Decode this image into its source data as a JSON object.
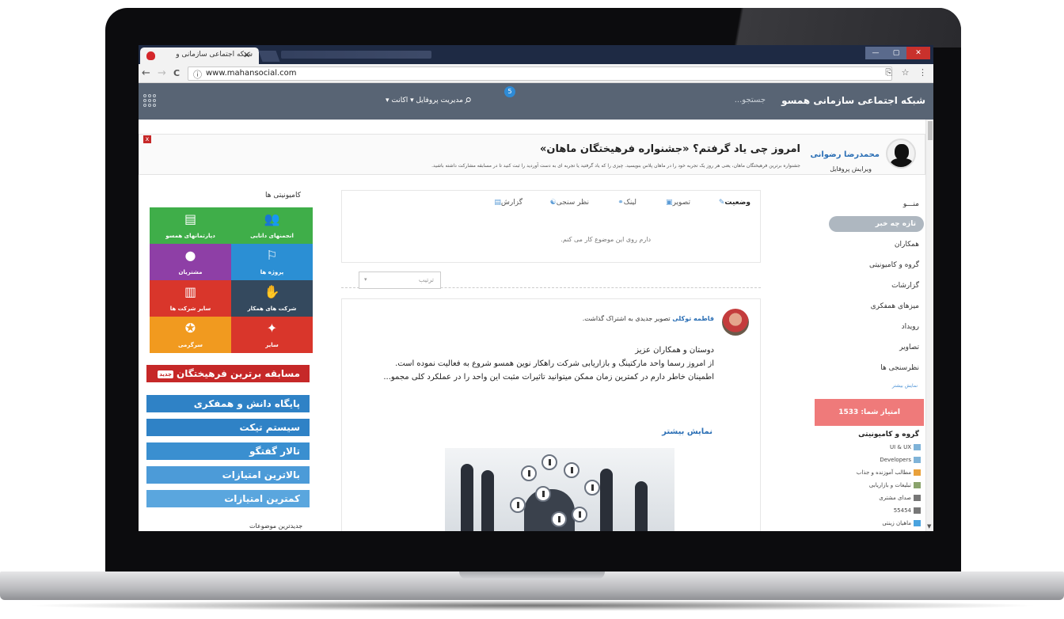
{
  "browser": {
    "tab_title": "شبکه اجتماعی سازمانی و",
    "tab_close": "✕",
    "url": "www.mahansocial.com",
    "nav_back": "←",
    "nav_forward": "→",
    "nav_reload": "C",
    "info_icon": "ⓘ",
    "translate_icon": "⎘",
    "bookmark_icon": "☆",
    "menu_icon": "⋮"
  },
  "header": {
    "brand": "شبکه اجتماعی سازمانی همسو",
    "search_placeholder": "جستجو...",
    "search_icon": "⌕",
    "notification_count": "5",
    "menu": "پنل مدیریت   پروفایل ▾   اکانت ▾"
  },
  "banner": {
    "user_name": "محمدرضا رضوانی",
    "edit_profile": "ویرایش پروفایل",
    "title": "امروز چی یاد گرفتم؟ «جشنواره فرهیختگان ماهان»",
    "description": "جشنواره برترین فرهیختگان ماهان، یعنی هر روز یک تجربه خود را در ماهان پلاس بنویسید. چیزی را که یاد گرفتید یا تجربه ای به دست آوردید را ثبت کنید تا در مسابقه مشارکت داشته باشید.",
    "close": "x"
  },
  "nav": {
    "title": "منـــو",
    "items": [
      "تازه چه خبر",
      "همکاران",
      "گروه و کامیونیتی",
      "گزارشات",
      "میزهای همفکری",
      "رویداد",
      "تصاویر",
      "نظرسنجی ها"
    ],
    "more": "نمایش بیشتر",
    "points": "امتیاز شما: 1533",
    "groups_title": "گروه و کامیونیتی",
    "groups": [
      "UI & UX",
      "Developers",
      "مطالب آموزنده و جذاب",
      "تبلیغات و بازاریابی",
      "صدای مشتری",
      "55454",
      "ماهیان زینتی"
    ]
  },
  "composer": {
    "tabs": [
      "وضعیت",
      "تصویر",
      "لینک",
      "نظر سنجی",
      "گزارش"
    ],
    "tab_icons": [
      "✎",
      "▣",
      "⚭",
      "☯",
      "▤"
    ],
    "placeholder": "دارم روی این موضوع کار می کنم.",
    "sort_label": "ترتیب",
    "sort_arrow": "▾"
  },
  "post": {
    "author": "فاطمه توکلی",
    "action": " تصویر جدیدی به اشتراک گذاشت.",
    "body": "دوستان و همکاران عزیز\nاز امروز رسما واحد مارکتینگ و بازاریابی شرکت راهکار نوین همسو شروع به فعالیت نموده است.\nاطمینان خاطر دارم در کمترین زمان ممکن میتوانید تاثیرات مثبت این واحد را در عملکرد کلی مجمو...",
    "more": "نمایش بیشتر"
  },
  "left": {
    "communities_title": "کامیونیتی ها",
    "tiles": [
      {
        "label": "انجمنهای دانایی",
        "icon": "👥",
        "color": "#3fae49"
      },
      {
        "label": "دپارتمانهای همسو",
        "icon": "▤",
        "color": "#3fae49"
      },
      {
        "label": "پروژه ها",
        "icon": "⚐",
        "color": "#2b8fd4"
      },
      {
        "label": "مشتریان",
        "icon": "●",
        "color": "#8e3fa6"
      },
      {
        "label": "شرکت های همکار",
        "icon": "✋",
        "color": "#34495e"
      },
      {
        "label": "سایر شرکت ها",
        "icon": "▥",
        "color": "#d9362b"
      },
      {
        "label": "سایر",
        "icon": "✦",
        "color": "#d9362b"
      },
      {
        "label": "سرگرمی",
        "icon": "✪",
        "color": "#f19a1f"
      }
    ],
    "buttons": [
      {
        "label": "مسابقه برترین فرهیختگان",
        "tag": "جدید",
        "color": "#c62828"
      },
      {
        "label": "پایگاه دانش و همفکری",
        "color": "#2f82c6"
      },
      {
        "label": "سیستم تیکت",
        "color": "#2f82c6"
      },
      {
        "label": "تالار گفتگو",
        "color": "#3a8fd0"
      },
      {
        "label": "بالاترین امتیازات",
        "color": "#4c9bd8"
      },
      {
        "label": "کمترین امتیازات",
        "color": "#5aa6de"
      }
    ],
    "latest_topics": "جدیدترین موضوعات"
  }
}
